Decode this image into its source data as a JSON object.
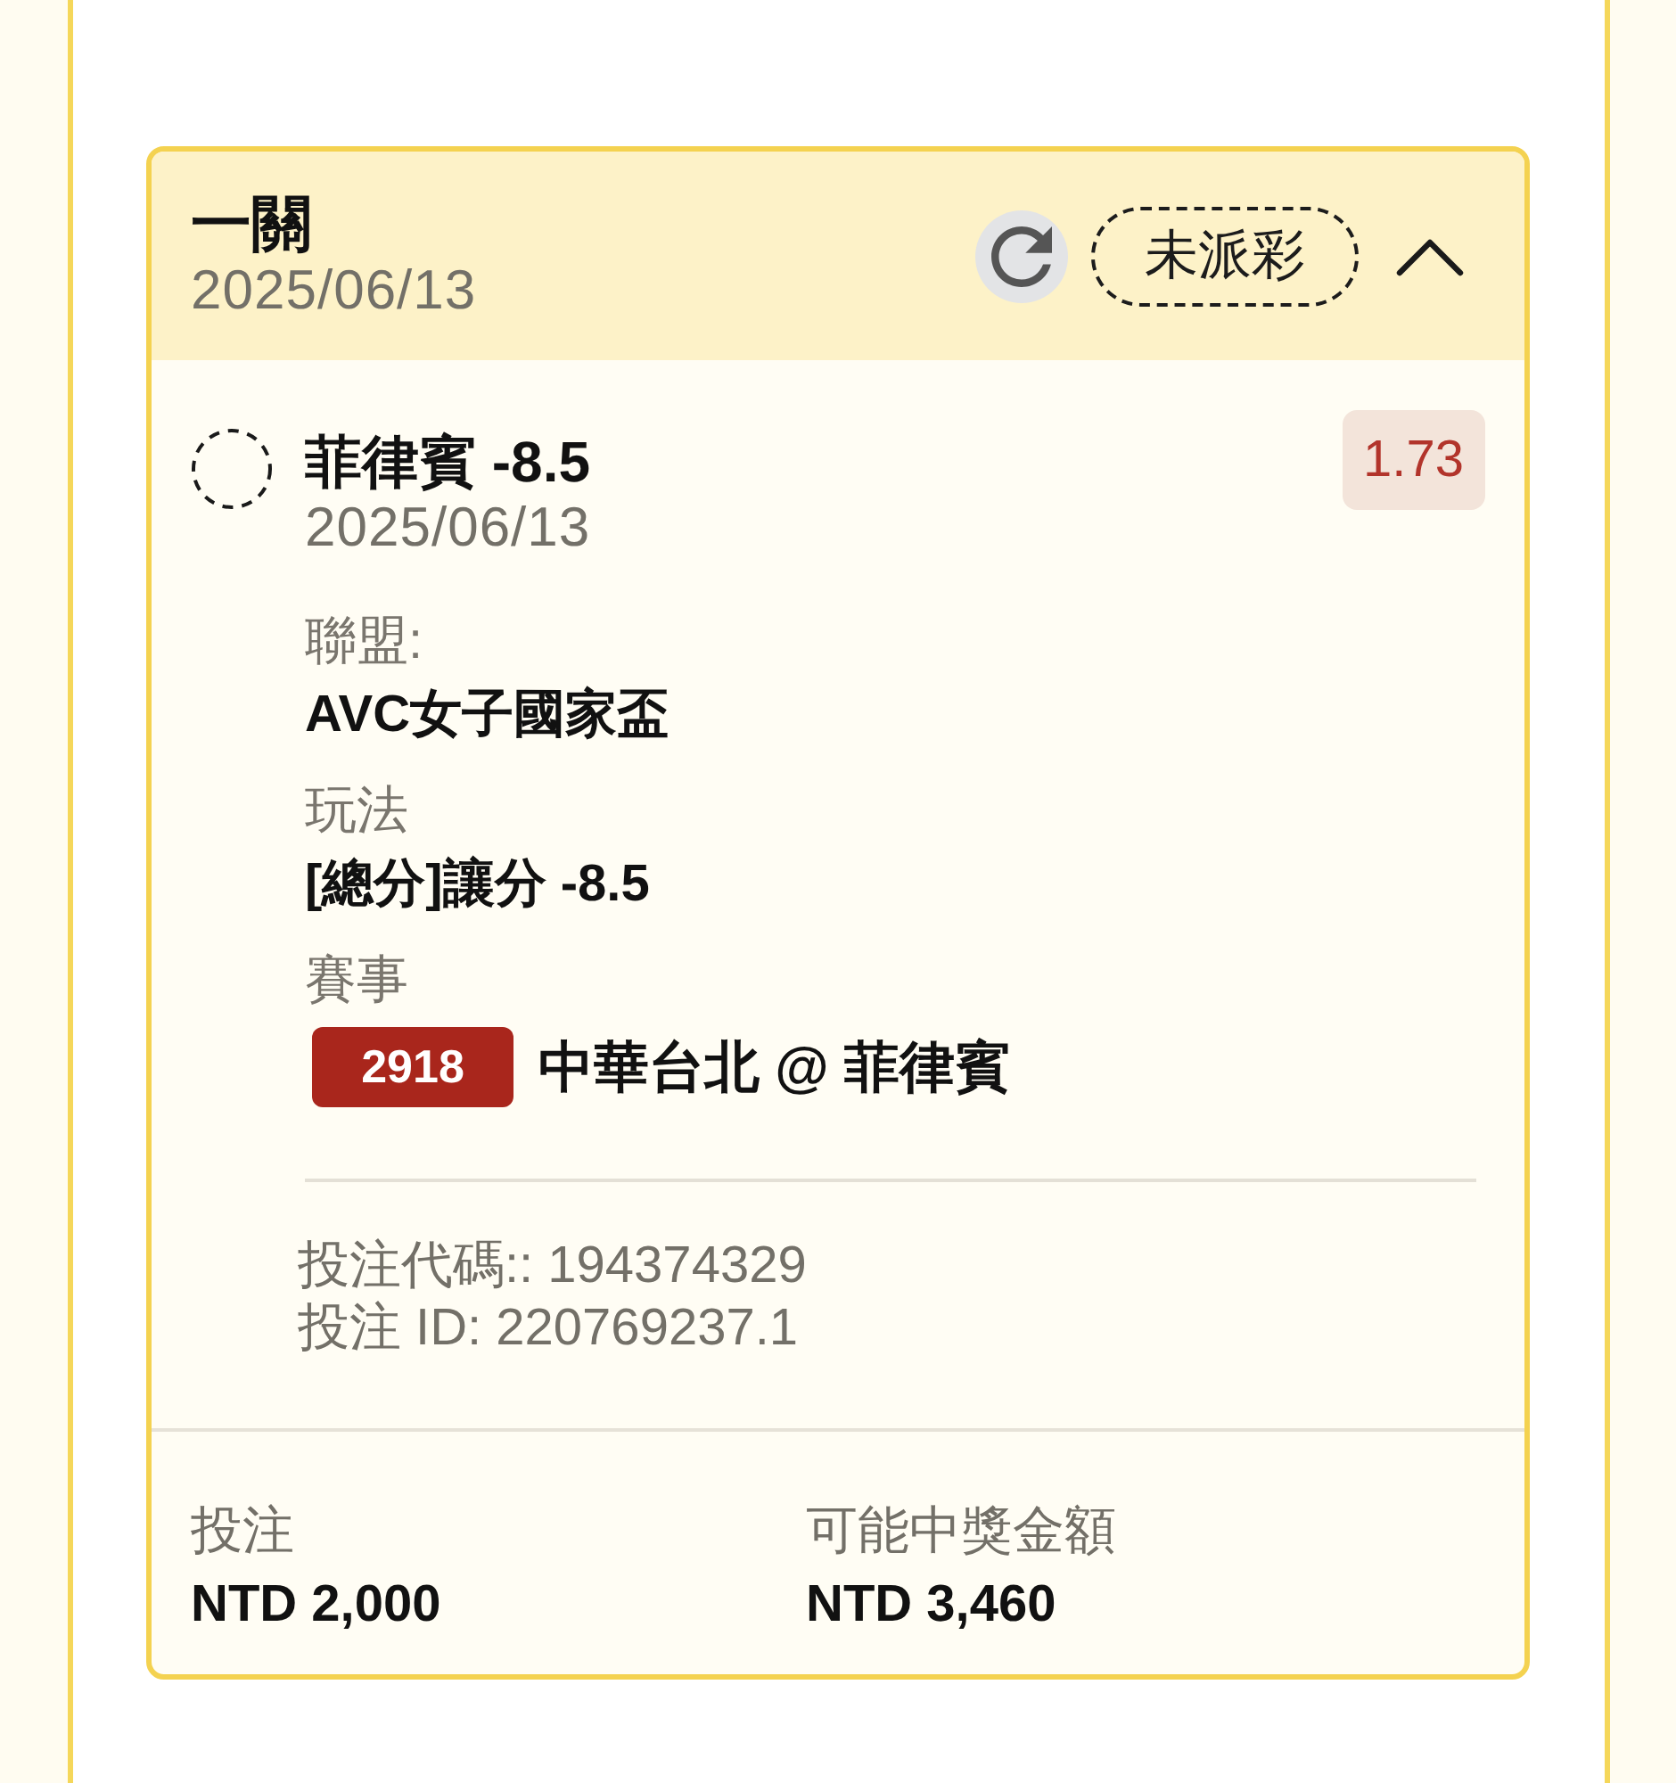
{
  "bet_card": {
    "header": {
      "title": "一關",
      "date": "2025/06/13",
      "status": "未派彩",
      "expanded": true
    },
    "selection": {
      "title": "菲律賓 -8.5",
      "date": "2025/06/13",
      "odds": "1.73",
      "details": [
        {
          "kind": "text",
          "label": "聯盟:",
          "value": "AVC女子國家盃"
        },
        {
          "kind": "text",
          "label": "玩法",
          "value": "[總分]讓分 -8.5"
        },
        {
          "kind": "event",
          "label": "賽事",
          "event_number": "2918",
          "value": "中華台北 @ 菲律賓"
        }
      ]
    },
    "bet_info": [
      "投注代碼:: 194374329",
      "投注 ID: 220769237.1"
    ],
    "summary": [
      {
        "label": "投注",
        "value": "NTD 2,000"
      },
      {
        "label": "可能中獎金額",
        "value": "NTD 3,460"
      }
    ]
  }
}
